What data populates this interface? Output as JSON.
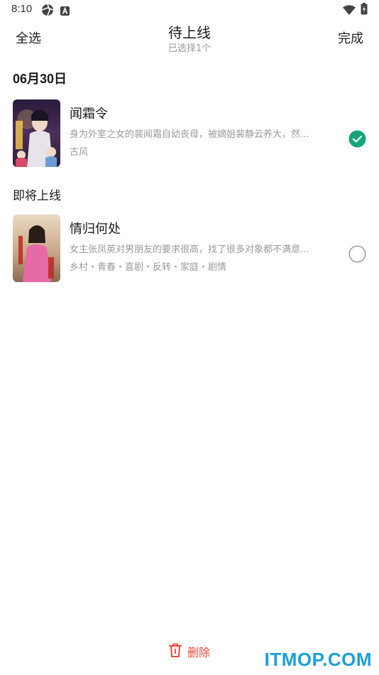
{
  "status_bar": {
    "time": "8:10",
    "icons": [
      "aperture-icon",
      "a-box-icon",
      "wifi-icon",
      "battery-icon"
    ]
  },
  "header": {
    "select_all": "全选",
    "title": "待上线",
    "subtitle": "已选择1个",
    "done": "完成"
  },
  "sections": [
    {
      "title": "06月30日",
      "items": [
        {
          "title": "闻霜令",
          "description": "身为外室之女的裴闻霜自幼丧母，被嫡姐裴静云养大，然...",
          "tags": "古风",
          "selected": true
        }
      ]
    },
    {
      "title": "即将上线",
      "items": [
        {
          "title": "情归何处",
          "description": "女主张凤英对男朋友的要求很高，找了很多对象都不满意...",
          "tags": "乡村・青春・喜剧・反转・家庭・剧情",
          "selected": false
        }
      ]
    }
  ],
  "footer": {
    "delete_label": "删除"
  },
  "watermark": "ITMOP.COM",
  "colors": {
    "accent_green": "#16a57a",
    "delete_red": "#e94a3c",
    "watermark_blue": "#1aa0d8"
  }
}
